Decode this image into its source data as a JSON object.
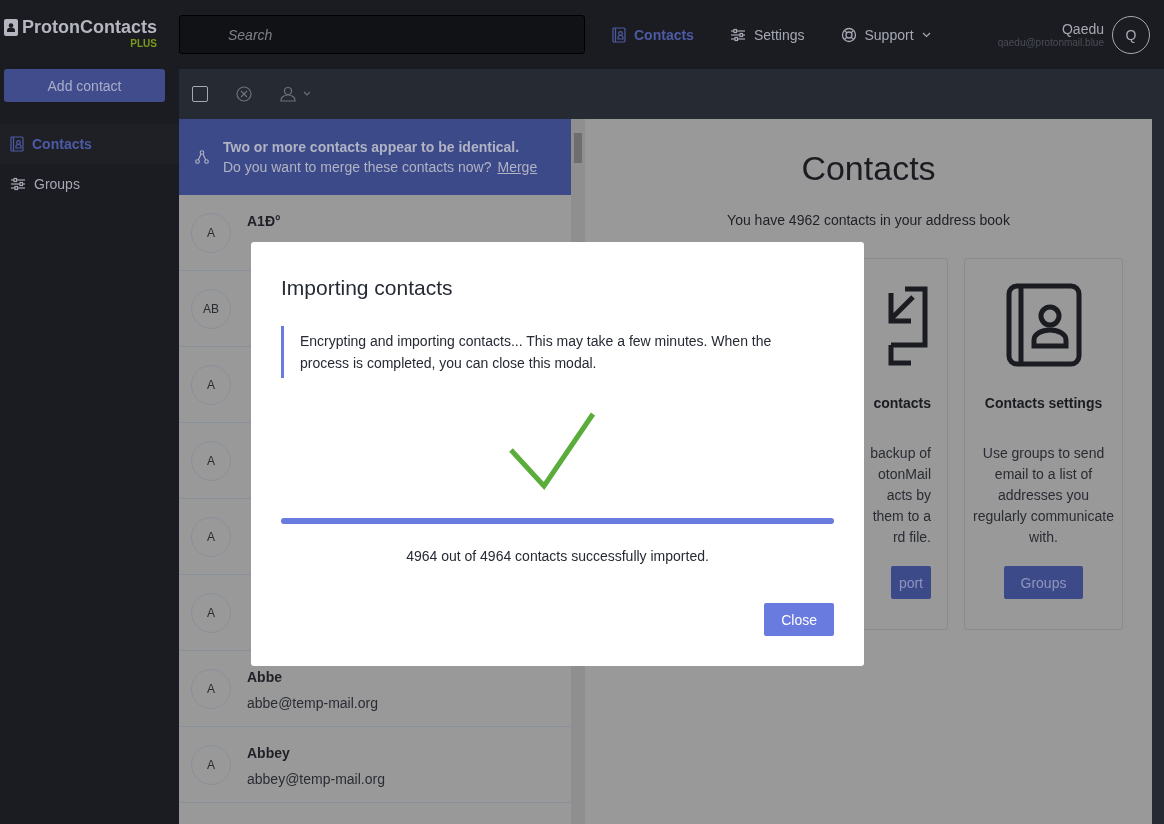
{
  "header": {
    "logo": {
      "name": "ProtonContacts",
      "plan": "PLUS"
    },
    "search": {
      "placeholder": "Search"
    },
    "nav": [
      {
        "kind": "contacts",
        "label": "Contacts",
        "selected": true,
        "dropdown": false
      },
      {
        "kind": "settings",
        "label": "Settings",
        "selected": false,
        "dropdown": false
      },
      {
        "kind": "support",
        "label": "Support",
        "selected": false,
        "dropdown": true
      }
    ],
    "user": {
      "name": "Qaedu",
      "email": "qaedu@protonmail.blue",
      "initial": "Q"
    }
  },
  "sidebar": {
    "add_button": "Add contact",
    "items": [
      {
        "kind": "contacts",
        "label": "Contacts",
        "selected": true
      },
      {
        "kind": "groups",
        "label": "Groups",
        "selected": false
      }
    ]
  },
  "toolbar": {
    "select_all": {
      "checked": false
    }
  },
  "banner": {
    "title": "Two or more contacts appear to be identical.",
    "text": "Do you want to merge these contacts now?",
    "link": "Merge"
  },
  "contacts": [
    {
      "initial": "A",
      "name": "A1Đ°"
    },
    {
      "initial": "AB"
    },
    {
      "initial": "A"
    },
    {
      "initial": "A"
    },
    {
      "initial": "A"
    },
    {
      "initial": "A"
    },
    {
      "initial": "A",
      "name": "Abbe",
      "email": "abbe@temp-mail.org"
    },
    {
      "initial": "A",
      "name": "Abbey",
      "email": "abbey@temp-mail.org"
    }
  ],
  "panel": {
    "title": "Contacts",
    "subtitle": "You have 4962 contacts in your address book",
    "cards": [
      {
        "kind": "partial",
        "title": "contacts",
        "lines": [
          "backup of",
          "otonMail",
          "acts by",
          "them to a",
          "rd file."
        ],
        "button": "port"
      },
      {
        "kind": "full",
        "title": "Contacts settings",
        "text": "Use groups to send email to a list of addresses you regularly communicate with.",
        "button": "Groups"
      }
    ]
  },
  "modal": {
    "title": "Importing contacts",
    "message": "Encrypting and importing contacts... This may take a few minutes. When the process is completed, you can close this modal.",
    "progress": {
      "level": 1
    },
    "status": "4964 out of 4964 contacts successfully imported.",
    "close_button": "Close"
  }
}
